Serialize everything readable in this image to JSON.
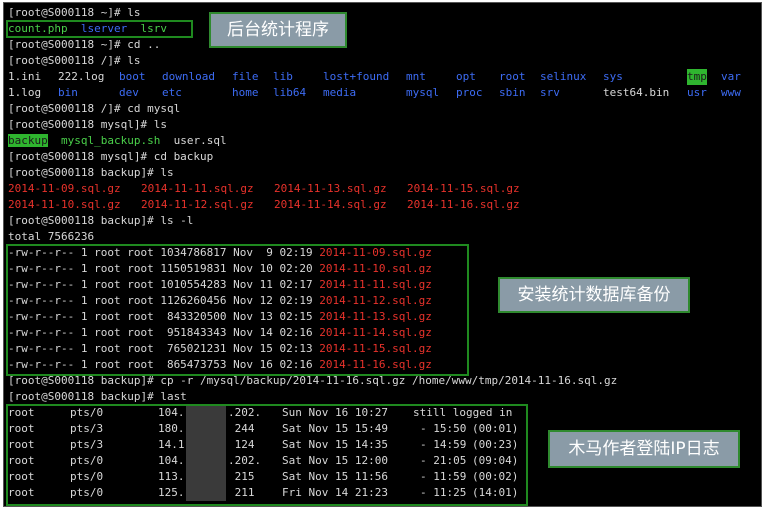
{
  "labels": {
    "backend": "后台统计程序",
    "backup": "安装统计数据库备份",
    "trojan": "木马作者登陆IP日志"
  },
  "lines": {
    "l1": "[root@S000118 ~]# ls",
    "l2_a": "count.php",
    "l2_b": "lserver",
    "l2_c": "lsrv",
    "l3": "[root@S000118 ~]# cd ..",
    "l4": "[root@S000118 /]# ls",
    "l7": "[root@S000118 /]# cd mysql",
    "l8": "[root@S000118 mysql]# ls",
    "l9_a": "backup",
    "l9_b": "mysql_backup.sh",
    "l9_c": "user.sql",
    "l10": "[root@S000118 mysql]# cd backup",
    "l11": "[root@S000118 backup]# ls",
    "l14": "[root@S000118 backup]# ls -l",
    "l15": "total 7566236",
    "l24": "[root@S000118 backup]# cp -r /mysql/backup/2014-11-16.sql.gz /home/www/tmp/2014-11-16.sql.gz",
    "l25": "[root@S000118 backup]# last"
  },
  "root_ls_row1": [
    {
      "t": "1.ini",
      "c": "white"
    },
    {
      "t": "222.log",
      "c": "white"
    },
    {
      "t": "boot",
      "c": "blue"
    },
    {
      "t": "download",
      "c": "blue"
    },
    {
      "t": "file",
      "c": "blue"
    },
    {
      "t": "lib",
      "c": "blue"
    },
    {
      "t": "lost+found",
      "c": "blue"
    },
    {
      "t": "mnt",
      "c": "blue"
    },
    {
      "t": "opt",
      "c": "blue"
    },
    {
      "t": "root",
      "c": "blue"
    },
    {
      "t": "selinux",
      "c": "blue"
    },
    {
      "t": "sys",
      "c": "blue"
    },
    {
      "t": "tmp",
      "c": "hl"
    },
    {
      "t": "var",
      "c": "blue"
    }
  ],
  "root_ls_row2": [
    {
      "t": "1.log",
      "c": "white"
    },
    {
      "t": "bin",
      "c": "blue"
    },
    {
      "t": "dev",
      "c": "blue"
    },
    {
      "t": "etc",
      "c": "blue"
    },
    {
      "t": "home",
      "c": "blue"
    },
    {
      "t": "lib64",
      "c": "blue"
    },
    {
      "t": "media",
      "c": "blue"
    },
    {
      "t": "mysql",
      "c": "blue"
    },
    {
      "t": "proc",
      "c": "blue"
    },
    {
      "t": "sbin",
      "c": "blue"
    },
    {
      "t": "srv",
      "c": "blue"
    },
    {
      "t": "test64.bin",
      "c": "white"
    },
    {
      "t": "usr",
      "c": "blue"
    },
    {
      "t": "www",
      "c": "blue"
    }
  ],
  "backup_ls": [
    [
      "2014-11-09.sql.gz",
      "2014-11-11.sql.gz",
      "2014-11-13.sql.gz",
      "2014-11-15.sql.gz"
    ],
    [
      "2014-11-10.sql.gz",
      "2014-11-12.sql.gz",
      "2014-11-14.sql.gz",
      "2014-11-16.sql.gz"
    ]
  ],
  "backup_ll": [
    {
      "meta": "-rw-r--r-- 1 root root 1034786817 Nov  9 02:19",
      "name": "2014-11-09.sql.gz"
    },
    {
      "meta": "-rw-r--r-- 1 root root 1150519831 Nov 10 02:20",
      "name": "2014-11-10.sql.gz"
    },
    {
      "meta": "-rw-r--r-- 1 root root 1010554283 Nov 11 02:17",
      "name": "2014-11-11.sql.gz"
    },
    {
      "meta": "-rw-r--r-- 1 root root 1126260456 Nov 12 02:19",
      "name": "2014-11-12.sql.gz"
    },
    {
      "meta": "-rw-r--r-- 1 root root  843320500 Nov 13 02:15",
      "name": "2014-11-13.sql.gz"
    },
    {
      "meta": "-rw-r--r-- 1 root root  951843343 Nov 14 02:16",
      "name": "2014-11-14.sql.gz"
    },
    {
      "meta": "-rw-r--r-- 1 root root  765021231 Nov 15 02:13",
      "name": "2014-11-15.sql.gz"
    },
    {
      "meta": "-rw-r--r-- 1 root root  865473753 Nov 16 02:16",
      "name": "2014-11-16.sql.gz"
    }
  ],
  "last_log": [
    {
      "user": "root",
      "tty": "pts/0",
      "ip_a": "104.",
      "ip_b": ".202.",
      "date": "Sun Nov 16 10:27",
      "range": "still logged in",
      "dur": ""
    },
    {
      "user": "root",
      "tty": "pts/3",
      "ip_a": "180.",
      "ip_b": " 244",
      "date": "Sat Nov 15 15:49",
      "range": "- 15:50",
      "dur": "(00:01)"
    },
    {
      "user": "root",
      "tty": "pts/3",
      "ip_a": "14.1",
      "ip_b": " 124",
      "date": "Sat Nov 15 14:35",
      "range": "- 14:59",
      "dur": "(00:23)"
    },
    {
      "user": "root",
      "tty": "pts/0",
      "ip_a": "104.",
      "ip_b": ".202.",
      "date": "Sat Nov 15 12:00",
      "range": "- 21:05",
      "dur": "(09:04)"
    },
    {
      "user": "root",
      "tty": "pts/0",
      "ip_a": "113.",
      "ip_b": " 215",
      "date": "Sat Nov 15 11:56",
      "range": "- 11:59",
      "dur": "(00:02)"
    },
    {
      "user": "root",
      "tty": "pts/0",
      "ip_a": "125.",
      "ip_b": " 211",
      "date": "Fri Nov 14 21:23",
      "range": "- 11:25",
      "dur": "(14:01)"
    }
  ],
  "colors": {
    "terminal_bg": "#000000",
    "dir_blue": "#3d6cf5",
    "exec_green": "#4ad04a",
    "archive_red": "#e8322b",
    "highlight_box": "#1f8a1f",
    "label_bg": "#8a9ba7"
  }
}
